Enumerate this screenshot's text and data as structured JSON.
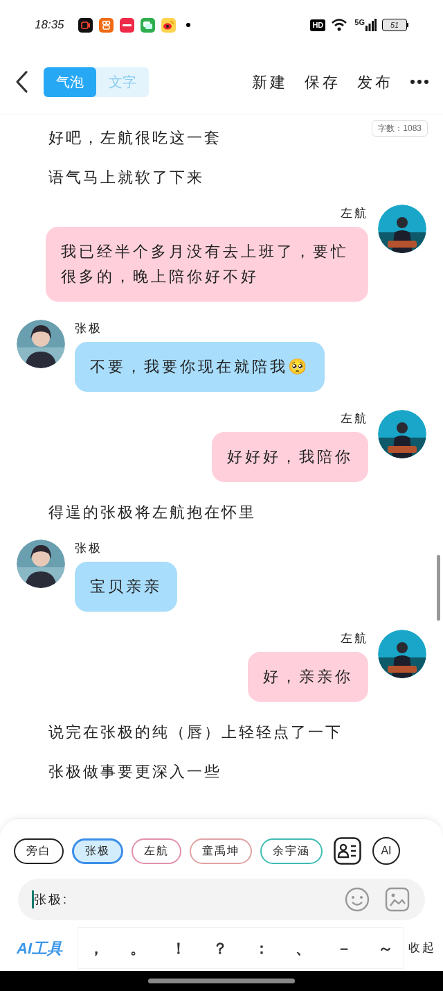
{
  "status_bar": {
    "time": "18:35",
    "network_badge": "HD",
    "network_type": "5G",
    "battery": "51"
  },
  "header": {
    "tabs": [
      {
        "label": "气泡",
        "selected": true
      },
      {
        "label": "文字",
        "selected": false
      }
    ],
    "actions": [
      "新建",
      "保存",
      "发布"
    ]
  },
  "word_count": "字数：1083",
  "story": [
    {
      "kind": "narration",
      "text": "好吧，左航很吃这一套"
    },
    {
      "kind": "narration",
      "text": "语气马上就软了下来"
    },
    {
      "kind": "sent",
      "speaker": "左航",
      "text": "我已经半个多月没有去上班了，要忙很多的，晚上陪你好不好"
    },
    {
      "kind": "received",
      "speaker": "张极",
      "text": "不要，我要你现在就陪我🥺"
    },
    {
      "kind": "sent",
      "speaker": "左航",
      "text": "好好好，我陪你"
    },
    {
      "kind": "narration",
      "text": "得逞的张极将左航抱在怀里"
    },
    {
      "kind": "received",
      "speaker": "张极",
      "text": "宝贝亲亲"
    },
    {
      "kind": "sent",
      "speaker": "左航",
      "text": "好，亲亲你"
    },
    {
      "kind": "narration",
      "text": "说完在张极的纯（唇）上轻轻点了一下"
    },
    {
      "kind": "narration",
      "text": "张极做事要更深入一些"
    }
  ],
  "characters": [
    {
      "name": "旁白",
      "color": "#222222",
      "selected": false
    },
    {
      "name": "张极",
      "color": "#3b8fe8",
      "selected": true
    },
    {
      "name": "左航",
      "color": "#e391ac",
      "selected": false
    },
    {
      "name": "童禹坤",
      "color": "#e0a3a3",
      "selected": false
    },
    {
      "name": "余宇涵",
      "color": "#3fbcb4",
      "selected": false
    }
  ],
  "ai_button": "AI",
  "input": {
    "value": "张极:"
  },
  "ai_tools": "AI工具",
  "punctuation": [
    "，",
    "。",
    "！",
    "？",
    "：",
    "、",
    "－",
    "～"
  ],
  "collapse": "收起"
}
